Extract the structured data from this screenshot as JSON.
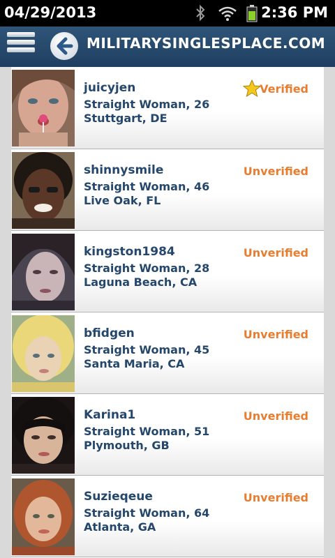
{
  "status_bar": {
    "date": "04/29/2013",
    "time": "2:36 PM",
    "icons": [
      "bluetooth-icon",
      "wifi-icon",
      "battery-icon"
    ]
  },
  "header": {
    "title": "MILITARYSINGLESPLACE.COM",
    "accent_color": "#24476b",
    "status_color": "#e87d2f"
  },
  "profiles": [
    {
      "username": "juicyjen",
      "detail": "Straight Woman, 26",
      "location": "Stuttgart, DE",
      "status": "Verified",
      "verified": true
    },
    {
      "username": "shinnysmile",
      "detail": "Straight Woman, 46",
      "location": "Live Oak, FL",
      "status": "Unverified",
      "verified": false
    },
    {
      "username": "kingston1984",
      "detail": "Straight Woman, 28",
      "location": "Laguna Beach, CA",
      "status": "Unverified",
      "verified": false
    },
    {
      "username": "bfidgen",
      "detail": "Straight Woman, 45",
      "location": "Santa Maria, CA",
      "status": "Unverified",
      "verified": false
    },
    {
      "username": "Karina1",
      "detail": "Straight Woman, 51",
      "location": "Plymouth, GB",
      "status": "Unverified",
      "verified": false
    },
    {
      "username": "Suzieqeue",
      "detail": "Straight Woman, 64",
      "location": "Atlanta, GA",
      "status": "Unverified",
      "verified": false
    }
  ]
}
